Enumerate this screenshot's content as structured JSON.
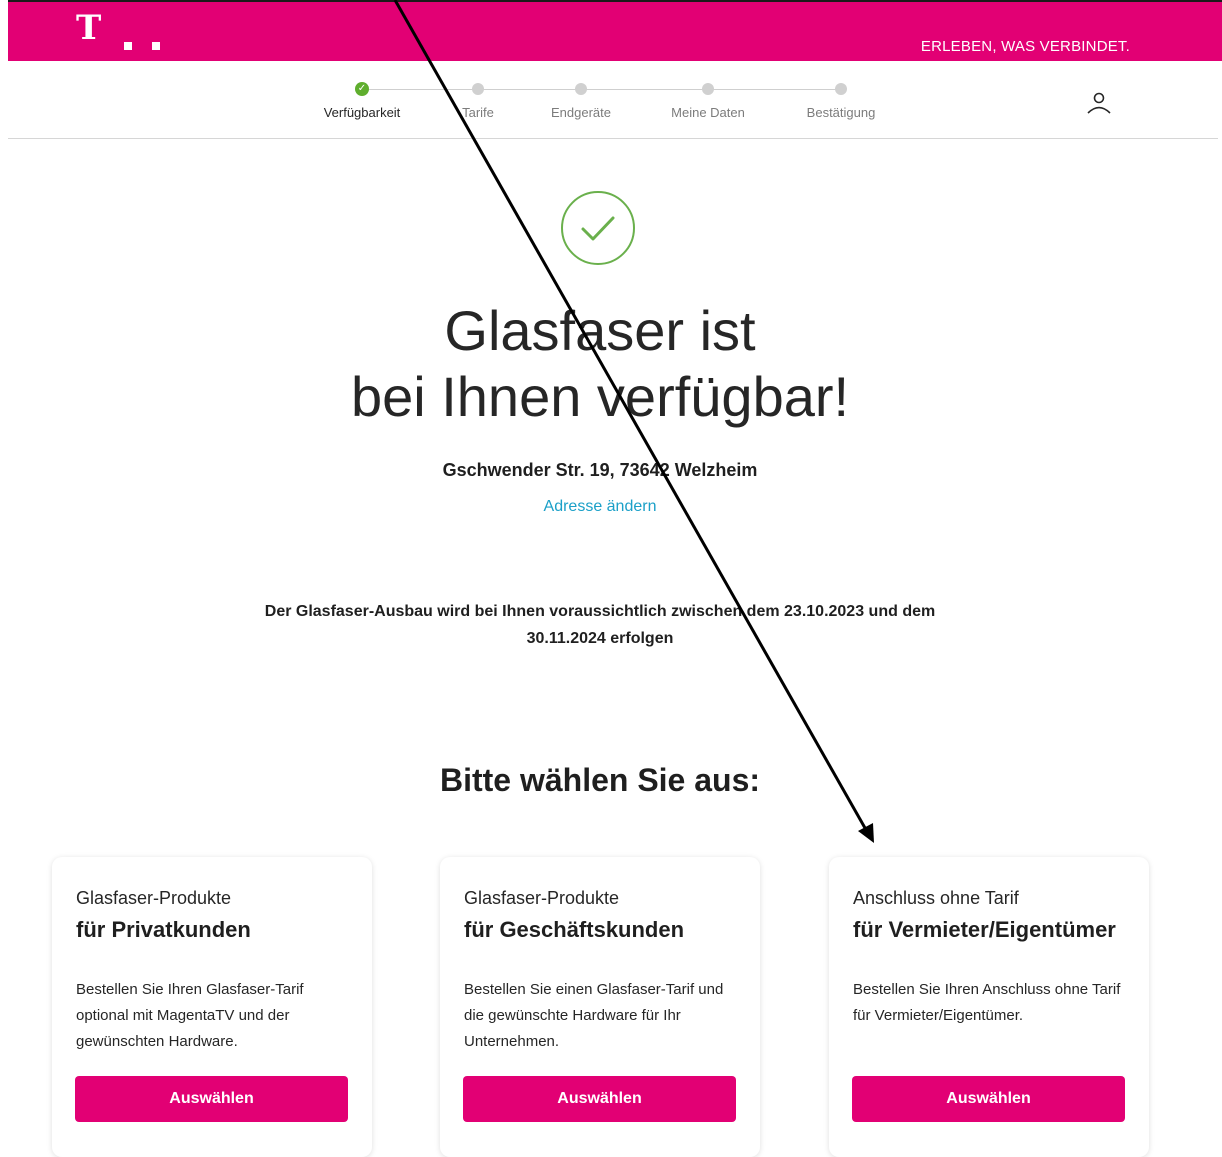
{
  "header": {
    "logo_letter": "T",
    "slogan": "ERLEBEN, WAS VERBINDET.",
    "brand_color": "#e20074"
  },
  "stepper": {
    "steps": [
      {
        "label": "Verfügbarkeit",
        "state": "done"
      },
      {
        "label": "Tarife",
        "state": "pending"
      },
      {
        "label": "Endgeräte",
        "state": "pending"
      },
      {
        "label": "Meine Daten",
        "state": "pending"
      },
      {
        "label": "Bestätigung",
        "state": "pending"
      }
    ],
    "done_color": "#5fae2e",
    "user_icon": "user-icon"
  },
  "result": {
    "icon": "check-circle-icon",
    "headline_line1": "Glasfaser ist",
    "headline_line2": "bei Ihnen verfügbar!",
    "address": "Gschwender Str. 19, 73642 Welzheim",
    "change_address_link": "Adresse ändern",
    "rollout_text": "Der Glasfaser-Ausbau wird bei Ihnen voraussichtlich zwischen dem 23.10.2023 und dem 30.11.2024 erfolgen"
  },
  "selection": {
    "title": "Bitte wählen Sie aus:",
    "cards": [
      {
        "kicker": "Glasfaser-Produkte",
        "title": "für Privatkunden",
        "description": "Bestellen Sie Ihren Glasfaser-Tarif optional mit MagentaTV und der gewünschten Hardware.",
        "button": "Auswählen"
      },
      {
        "kicker": "Glasfaser-Produkte",
        "title": "für Geschäftskunden",
        "description": "Bestellen Sie einen Glasfaser-Tarif und die gewünschte Hardware für Ihr Unternehmen.",
        "button": "Auswählen"
      },
      {
        "kicker": "Anschluss ohne Tarif",
        "title": "für Vermieter/Eigentümer",
        "description": "Bestellen Sie Ihren Anschluss ohne Tarif für Vermieter/Eigentümer.",
        "button": "Auswählen"
      }
    ]
  },
  "annotation": {
    "type": "arrow",
    "color": "#000000"
  }
}
